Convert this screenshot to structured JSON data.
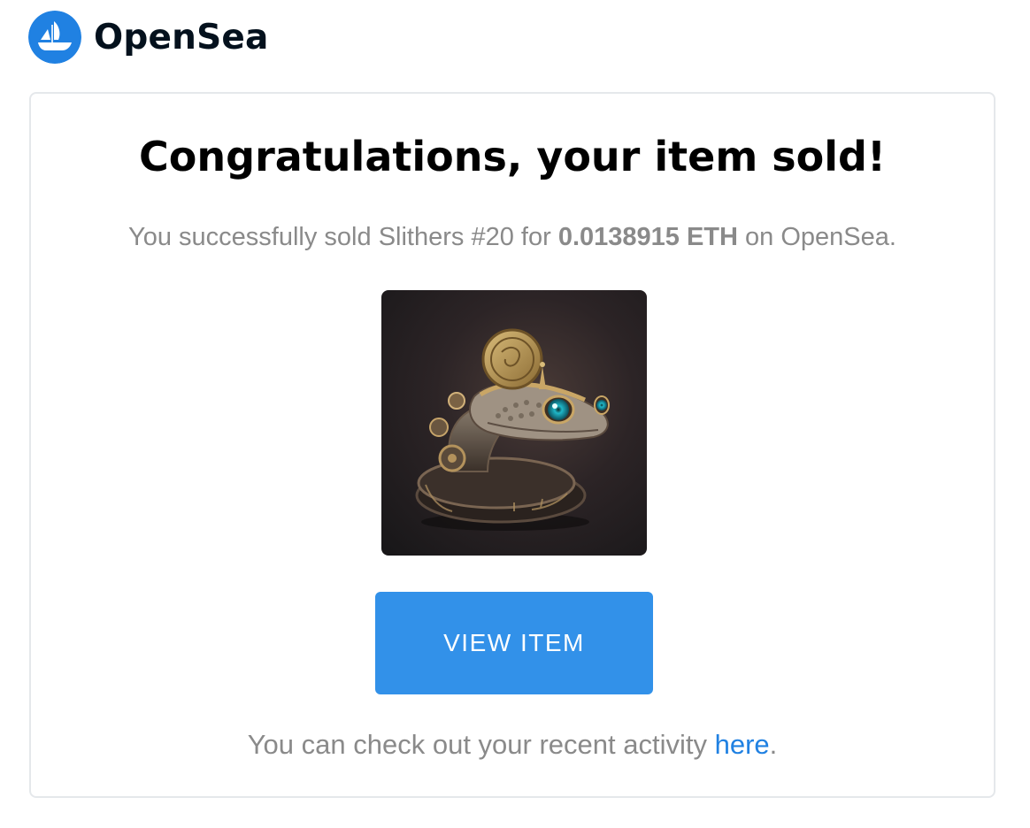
{
  "header": {
    "brand_name": "OpenSea"
  },
  "email": {
    "title": "Congratulations, your item sold!",
    "message": {
      "prefix": "You successfully sold ",
      "item_name": "Slithers #20",
      "middle": " for ",
      "amount": "0.0138915 ETH",
      "suffix": " on OpenSea."
    },
    "nft_image_alt": "Slithers #20",
    "button_label": "VIEW ITEM",
    "footer": {
      "prefix": "You can check out your recent activity ",
      "link_text": "here",
      "suffix": "."
    }
  },
  "colors": {
    "brand_blue": "#2081e2",
    "button_blue": "#3291e9",
    "text_gray": "#8a8a8a"
  }
}
